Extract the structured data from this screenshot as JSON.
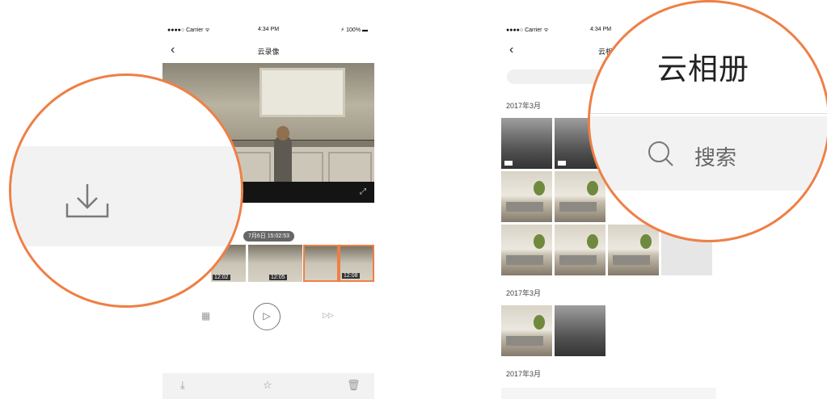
{
  "left_phone": {
    "status": {
      "carrier": "●●●●○ Carrier ᯤ",
      "time": "4:34 PM",
      "battery": "⚡ 100% ▬"
    },
    "nav": {
      "back": "‹",
      "title": "云录像"
    },
    "timestamp": "7月6日 15:02:53",
    "thumbnails": [
      {
        "time": "12:02"
      },
      {
        "time": "12:05"
      },
      {
        "time": "12:08"
      }
    ],
    "controls": {
      "calendar": "▦",
      "play": "▷",
      "forward": "▷▷"
    },
    "bottom": {
      "download": "⤓",
      "star": "☆",
      "trash": "🗑"
    }
  },
  "right_phone": {
    "status": {
      "carrier": "●●●●○ Carrier ᯤ",
      "time": "4:34 PM"
    },
    "nav": {
      "back": "‹",
      "title": "云相册"
    },
    "sections": [
      {
        "label": "2017年3月"
      },
      {
        "label": "2017年3月"
      },
      {
        "label": "2017年3月"
      }
    ],
    "more": "···"
  },
  "magnifier_right": {
    "title": "云相册",
    "search_placeholder": "搜索"
  },
  "colors": {
    "accent": "#ef7f45"
  },
  "icons": {
    "download": "download-icon",
    "search": "search-icon"
  }
}
